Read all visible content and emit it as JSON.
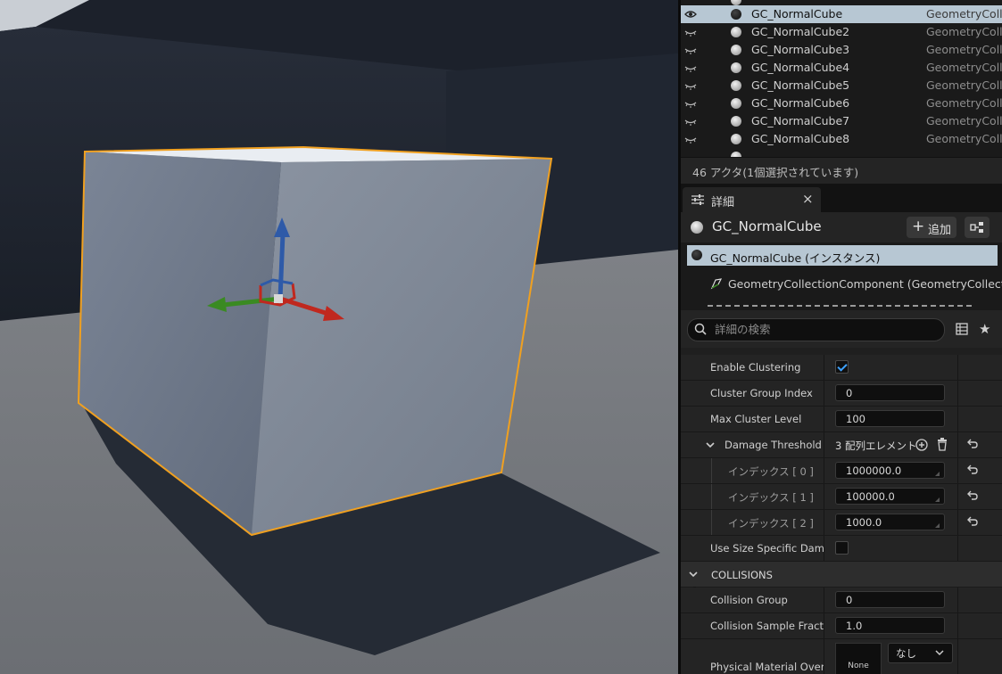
{
  "outliner": {
    "rows": [
      {
        "name": "GC_NormalCube",
        "type": "GeometryColle",
        "selected": true
      },
      {
        "name": "GC_NormalCube2",
        "type": "GeometryColle"
      },
      {
        "name": "GC_NormalCube3",
        "type": "GeometryColle"
      },
      {
        "name": "GC_NormalCube4",
        "type": "GeometryColle"
      },
      {
        "name": "GC_NormalCube5",
        "type": "GeometryColle"
      },
      {
        "name": "GC_NormalCube6",
        "type": "GeometryColle"
      },
      {
        "name": "GC_NormalCube7",
        "type": "GeometryColle"
      },
      {
        "name": "GC_NormalCube8",
        "type": "GeometryColle"
      }
    ],
    "status": "46 アクタ(1個選択されています)"
  },
  "details_tab": {
    "label": "詳細",
    "close_glyph": "×"
  },
  "actor": {
    "name": "GC_NormalCube",
    "add_button": "追加",
    "add_glyph": "+"
  },
  "components": {
    "root": "GC_NormalCube (インスタンス)",
    "child": "GeometryCollectionComponent (GeometryCollection"
  },
  "search": {
    "placeholder": "詳細の検索"
  },
  "properties": {
    "enable_clustering": {
      "label": "Enable Clustering",
      "checked": true
    },
    "cluster_group_index": {
      "label": "Cluster Group Index",
      "value": "0"
    },
    "max_cluster_level": {
      "label": "Max Cluster Level",
      "value": "100"
    },
    "damage_threshold": {
      "label": "Damage Threshold",
      "summary": "3 配列エレメント",
      "items": [
        {
          "label": "インデックス [ 0 ]",
          "value": "1000000.0"
        },
        {
          "label": "インデックス [ 1 ]",
          "value": "100000.0"
        },
        {
          "label": "インデックス [ 2 ]",
          "value": "1000.0"
        }
      ]
    },
    "use_size_specific_damage": {
      "label": "Use Size Specific Damag",
      "checked": false
    },
    "collisions_section": "COLLISIONS",
    "collision_group": {
      "label": "Collision Group",
      "value": "0"
    },
    "collision_sample_fraction": {
      "label": "Collision Sample Fraction",
      "value": "1.0"
    },
    "physical_material_override": {
      "label": "Physical Material Overrid",
      "thumb": "None",
      "select": "なし"
    }
  },
  "icons": {
    "visibility": "eye-icon",
    "hidden": "eye-closed-icon",
    "actor": "sphere-icon",
    "details": "sliders-icon",
    "search": "search-icon",
    "favorite": "star-icon",
    "table": "table-icon",
    "reset": "reset-arrow-icon",
    "add_element": "plus-circle-icon",
    "delete": "trash-icon"
  },
  "colors": {
    "selection": "#b7c7d3",
    "checkbox": "#3ea2ff",
    "selection_outline": "#f0a020",
    "gizmo_x": "#c0281e",
    "gizmo_y": "#3a8a22",
    "gizmo_z": "#2e5aa8"
  }
}
